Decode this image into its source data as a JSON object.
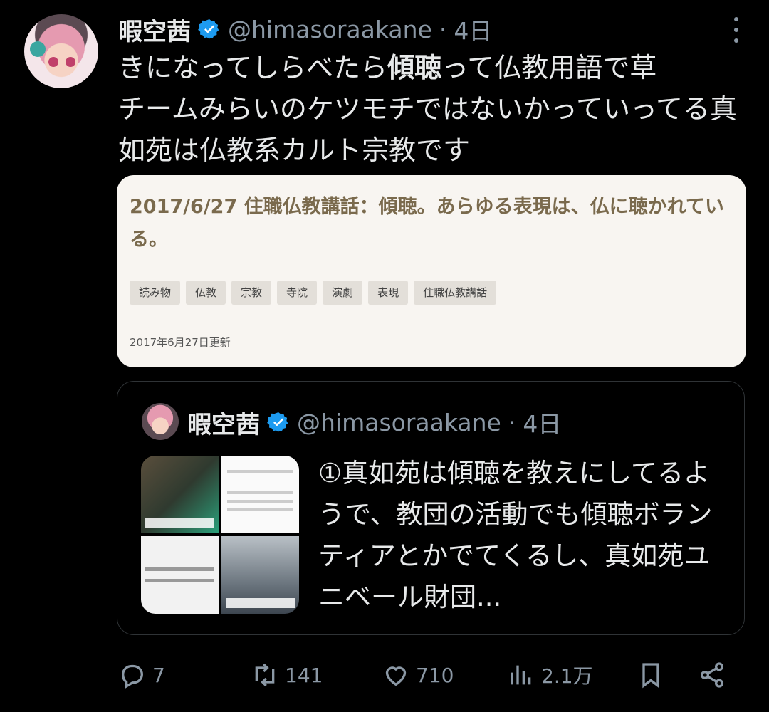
{
  "tweet": {
    "author_name": "暇空茜",
    "handle": "@himasoraakane",
    "separator": "·",
    "time": "4日",
    "text_before_bold": "きになってしらべたら",
    "text_bold": "傾聴",
    "text_after_bold": "って仏教用語で草\nチームみらいのケツモチではないかっていってる真如苑は仏教系カルト宗教です"
  },
  "link_card": {
    "title": "2017/6/27 住職仏教講話：傾聴。あらゆる表現は、仏に聴かれている。",
    "tags": [
      "読み物",
      "仏教",
      "宗教",
      "寺院",
      "演劇",
      "表現",
      "住職仏教講話"
    ],
    "updated": "2017年6月27日更新"
  },
  "quote": {
    "author_name": "暇空茜",
    "handle": "@himasoraakane",
    "separator": "·",
    "time": "4日",
    "text": "①真如苑は傾聴を教えにしてるようで、教団の活動でも傾聴ボランティアとかでてくるし、真如苑ユニベール財団..."
  },
  "actions": {
    "replies": "7",
    "retweets": "141",
    "likes": "710",
    "views": "2.1万"
  },
  "colors": {
    "background": "#000000",
    "text": "#e7e9ea",
    "muted": "#8b98a5",
    "verified": "#1d9bf0",
    "card_bg": "#f8f5f1",
    "card_title": "#7a6a4d"
  },
  "icons": {
    "more": "more-vertical-icon",
    "verified": "verified-badge-icon",
    "reply": "reply-icon",
    "retweet": "retweet-icon",
    "like": "heart-icon",
    "views": "analytics-icon",
    "bookmark": "bookmark-icon",
    "share": "share-icon"
  }
}
